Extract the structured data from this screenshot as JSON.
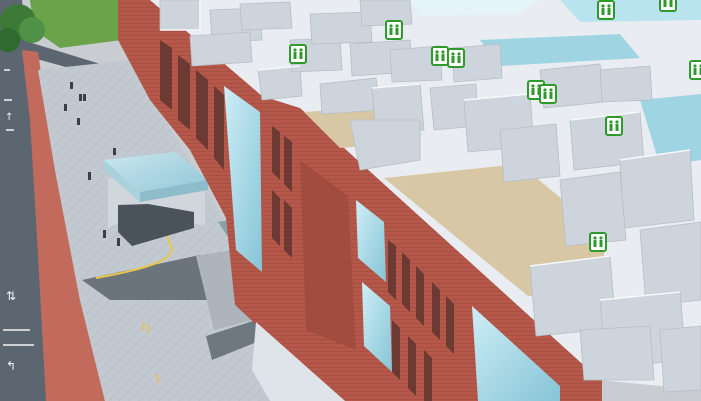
{
  "scene": {
    "kind": "3d-isometric-building-model",
    "elements": [
      "road-with-lane-arrows",
      "tree",
      "grass-lawn",
      "brick-sidewalk",
      "paved-plaza",
      "pedestrians",
      "glass-canopy-entrance",
      "brick-facade-building",
      "open-roof-floor-plan-interior",
      "green-restroom-markers"
    ],
    "marker_icon": "restroom-icon",
    "colors": {
      "brick": "#b5584a",
      "brick_dark": "#8e4238",
      "wall": "#dde3ea",
      "floor": "#d7c7a4",
      "glass": "#9fd4e2",
      "road": "#5c6670",
      "plaza": "#c2c8cf",
      "grass": "#6aa34a",
      "marker_green": "#2f9a2c"
    }
  }
}
